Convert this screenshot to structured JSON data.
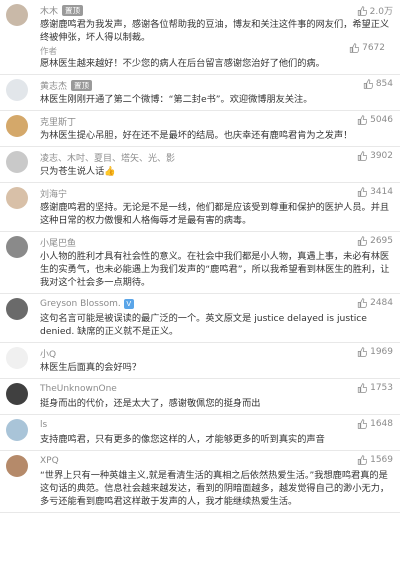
{
  "comments": [
    {
      "name": "木木",
      "badge": "置顶",
      "likes": "2.0万",
      "text": "感谢鹿鸣君为我发声，感谢各位帮助我的豆油，博友和关注这件事的网友们，希望正义终被伸张，坏人得以制裁。",
      "author_tag": "作者",
      "reply": "愿林医生越来越好！不少您的病人在后台留言感谢您治好了他们的病。",
      "reply_likes": "7672",
      "avatar": "#c9b9a8"
    },
    {
      "name": "黄志杰",
      "badge": "置顶",
      "likes": "854",
      "text": "林医生刚刚开通了第二个微博：“第二封e书”。欢迎微博朋友关注。",
      "avatar": "#e2e6ea"
    },
    {
      "name": "克里斯丁",
      "likes": "5046",
      "text": "为林医生提心吊胆，好在还不是最坏的结局。也庆幸还有鹿鸣君肯为之发声！",
      "avatar": "#d4a86a"
    },
    {
      "name": "凌志、木吋、夏目、塔矢、光、影",
      "likes": "3902",
      "text": "只为苍生说人话👍",
      "avatar": "#c9c9c9"
    },
    {
      "name": "刘海宁",
      "likes": "3414",
      "text": "感谢鹿鸣君的坚持。无论是不是一线，他们都是应该受到尊重和保护的医护人员。并且这种日常的权力傲慢和人格侮辱才是最有害的病毒。",
      "avatar": "#d8c0a8"
    },
    {
      "name": "小尾巴鱼",
      "likes": "2695",
      "text": "小人物的胜利才具有社会性的意义。在社会中我们都是小人物，真遇上事，未必有林医生的实勇气，也未必能遇上为我们发声的“鹿鸣君”，所以我希望看到林医生的胜利，让我对这个社会多一点期待。",
      "avatar": "#8a8a8a"
    },
    {
      "name": "Greyson Blossom.",
      "likes": "2484",
      "text": "这句名言可能是被误读的最广泛的一个。英文原文是 justice delayed is justice denied. 缺席的正义就不是正义。",
      "avatar": "#6a6a6a",
      "vip": "V"
    },
    {
      "name": "小Q",
      "likes": "1969",
      "text": "林医生后面真的会好吗？",
      "avatar": "#f0f0f0"
    },
    {
      "name": "TheUnknownOne",
      "likes": "1753",
      "text": "挺身而出的代价，还是太大了，感谢敬佩您的挺身而出",
      "avatar": "#404040"
    },
    {
      "name": "ls",
      "likes": "1648",
      "text": "支持鹿鸣君，只有更多的像您这样的人，才能够更多的听到真实的声音",
      "avatar": "#a9c4d8"
    },
    {
      "name": "XPQ",
      "likes": "1569",
      "text": "“世界上只有一种英雄主义,就是看清生活的真相之后依然热爱生活。”我想鹿鸣君真的是这句话的典范。信息社会越来越发达，看到的阴暗面越多，越发觉得自己的渺小无力，多亏还能看到鹿鸣君这样敢于发声的人，我才能继续热爱生活。",
      "avatar": "#b58a6a"
    }
  ]
}
